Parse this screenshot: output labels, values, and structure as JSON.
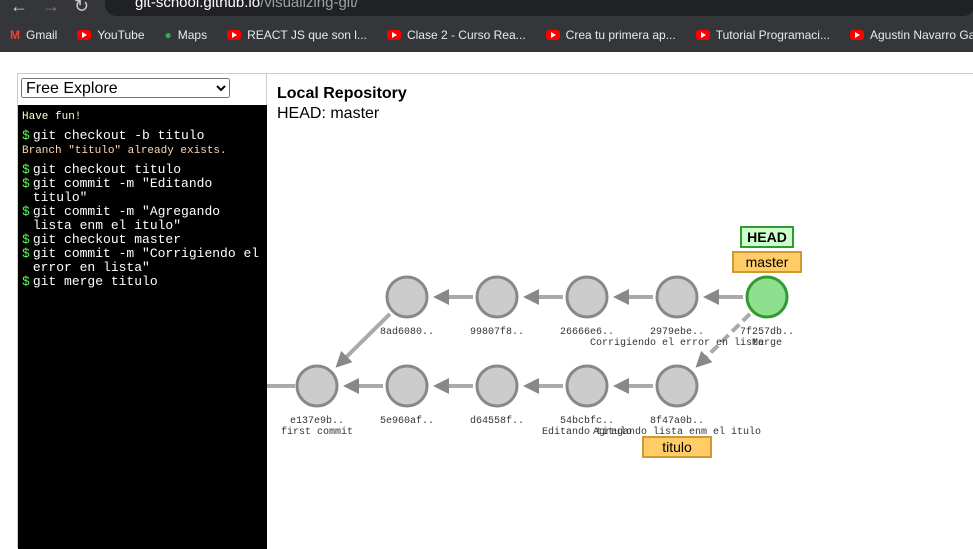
{
  "browser": {
    "url_host": "git-school.github.io",
    "url_path": "/visualizing-git/",
    "bookmarks": [
      "Gmail",
      "YouTube",
      "Maps",
      "REACT JS que son l...",
      "Clase 2 - Curso Rea...",
      "Crea tu primera ap...",
      "Tutorial Programaci...",
      "Agustin Navarro Ga..."
    ]
  },
  "mode_select": {
    "value": "Free Explore"
  },
  "terminal": {
    "greeting": "Have fun!",
    "entries": [
      {
        "cmd": "git checkout -b titulo",
        "out": "Branch \"titulo\" already exists."
      },
      {
        "cmd": "git checkout titulo"
      },
      {
        "cmd": "git commit -m \"Editando titulo\""
      },
      {
        "cmd": "git commit -m \"Agregando lista enm el itulo\""
      },
      {
        "cmd": "git checkout master"
      },
      {
        "cmd": "git commit -m \"Corrigiendo el error en lista\""
      },
      {
        "cmd": "git merge titulo"
      }
    ],
    "prompt": "$"
  },
  "repo": {
    "title": "Local Repository",
    "head_label": "HEAD: master",
    "commits": [
      {
        "id": "8ad6080..",
        "row": 0,
        "col": 1,
        "parents": [
          "e137e9b.."
        ]
      },
      {
        "id": "99807f8..",
        "row": 0,
        "col": 2,
        "parents": [
          "8ad6080.."
        ]
      },
      {
        "id": "26666e6..",
        "row": 0,
        "col": 3,
        "parents": [
          "99807f8.."
        ]
      },
      {
        "id": "2979ebe..",
        "row": 0,
        "col": 4,
        "msg": "Corrigiendo el error en lista",
        "parents": [
          "26666e6.."
        ]
      },
      {
        "id": "7f257db..",
        "row": 0,
        "col": 5,
        "msg": "Merge",
        "head": true,
        "parents": [
          "2979ebe..",
          "8f47a0b.."
        ]
      },
      {
        "id": "e137e9b..",
        "row": 1,
        "col": 0,
        "msg": "first commit",
        "parents": [
          "_"
        ]
      },
      {
        "id": "5e960af..",
        "row": 1,
        "col": 1,
        "parents": [
          "e137e9b.."
        ]
      },
      {
        "id": "d64558f..",
        "row": 1,
        "col": 2,
        "parents": [
          "5e960af.."
        ]
      },
      {
        "id": "54bcbfc..",
        "row": 1,
        "col": 3,
        "msg": "Editando titulo",
        "parents": [
          "d64558f.."
        ]
      },
      {
        "id": "8f47a0b..",
        "row": 1,
        "col": 4,
        "msg": "Agregando lista enm el itulo",
        "parents": [
          "54bcbfc.."
        ]
      }
    ],
    "refs": {
      "head": "HEAD",
      "master": "master",
      "titulo": "titulo"
    },
    "colors": {
      "commit": "#cccccc",
      "head_commit": "#8ee08e",
      "branch": "#ffcc66",
      "head_tag": "#ccffcc"
    }
  }
}
